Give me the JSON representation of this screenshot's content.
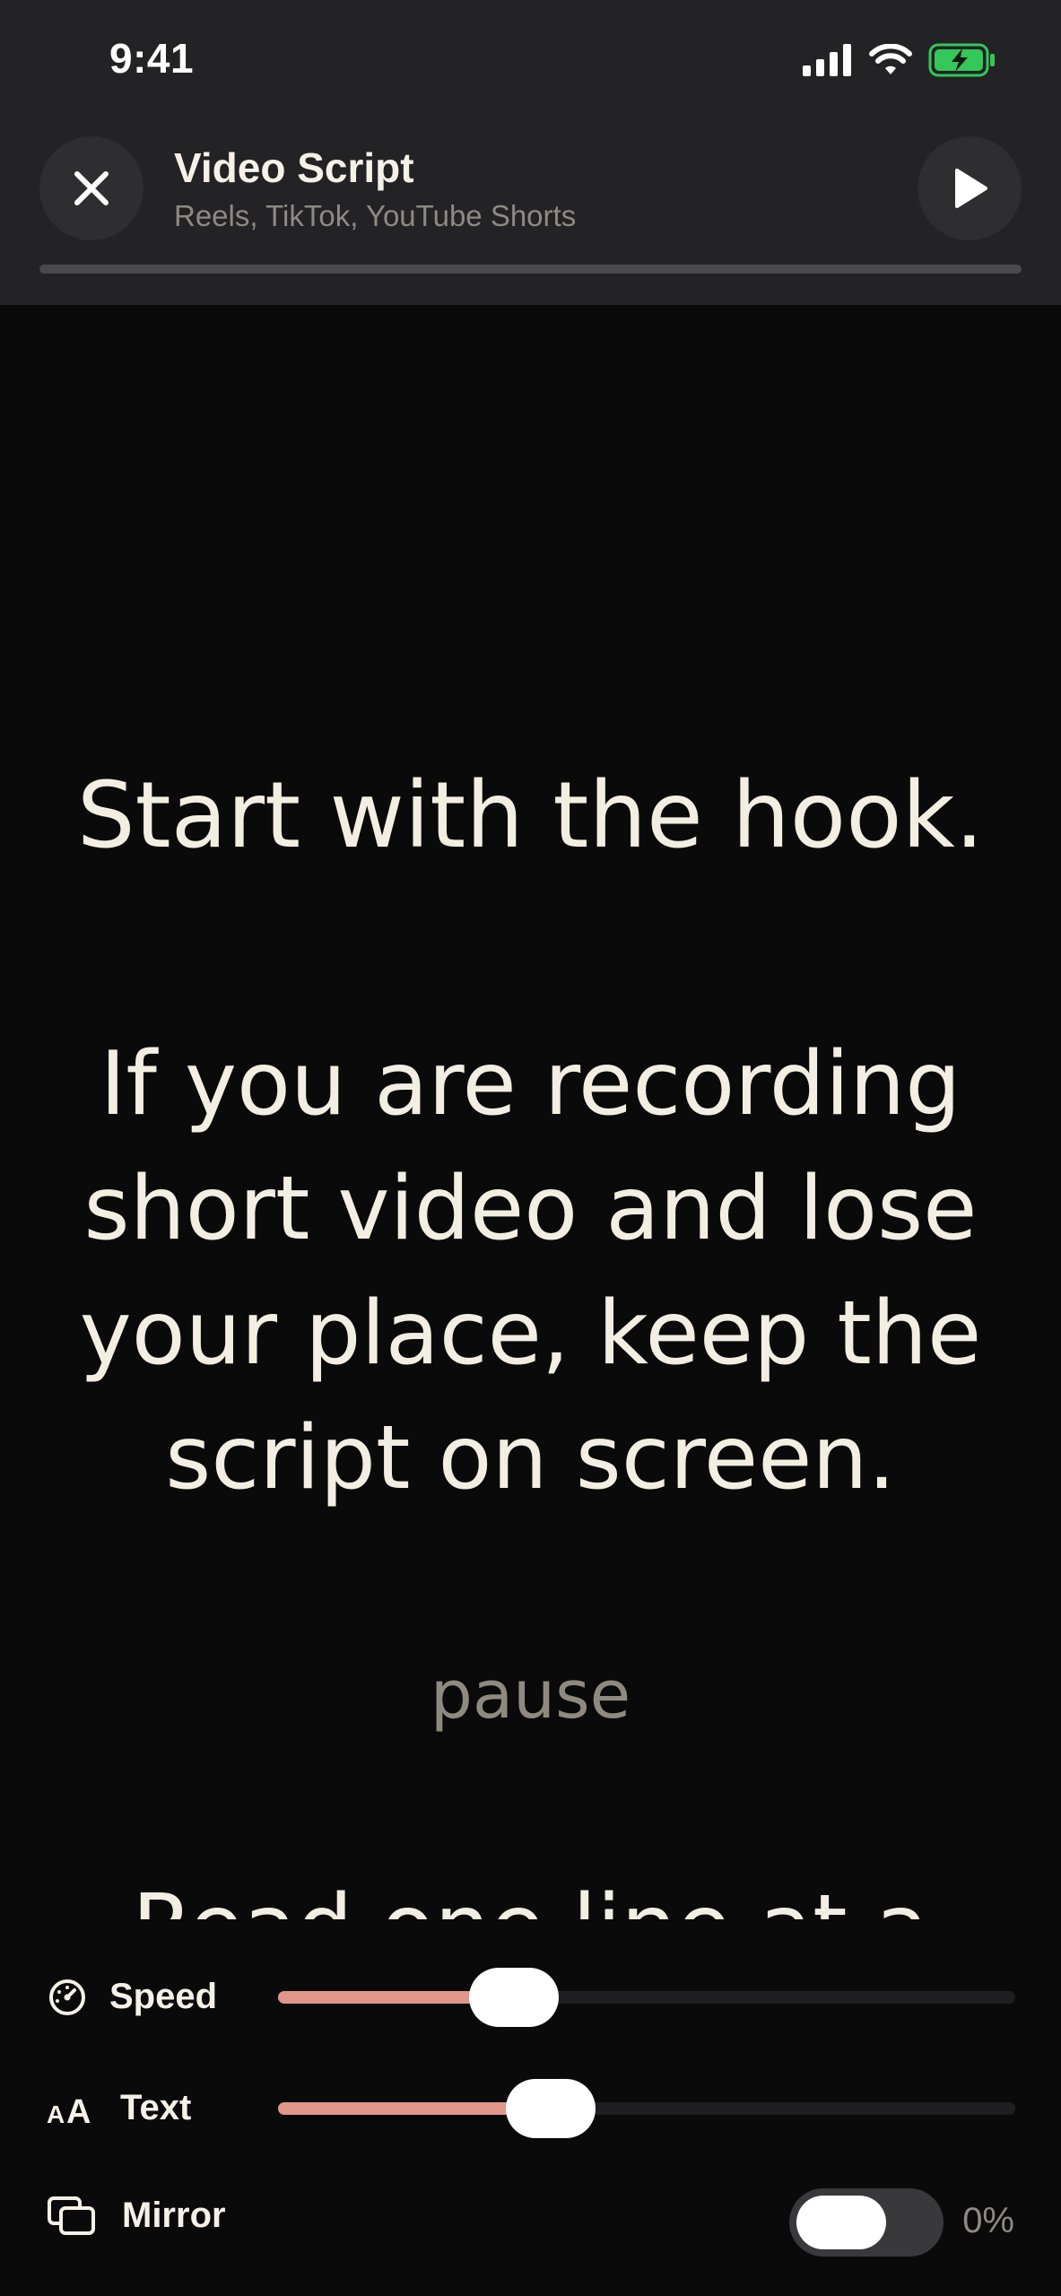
{
  "status_bar": {
    "time": "9:41"
  },
  "header": {
    "title": "Video Script",
    "subtitle": "Reels, TikTok, YouTube Shorts",
    "progress": 0
  },
  "script": {
    "hook": "Start with the hook.",
    "paragraph_lines": [
      "If you are recording",
      "short video and lose",
      "your place, keep the",
      "script on screen."
    ],
    "pause": "pause",
    "next_partial": "Read one line at a"
  },
  "controls": {
    "speed": {
      "label": "Speed",
      "value": 0.32
    },
    "text": {
      "label": "Text",
      "value": 0.37
    },
    "mirror": {
      "label": "Mirror",
      "value_text": "0%",
      "enabled": false
    }
  },
  "colors": {
    "accent": "#e1968a",
    "header_bg": "#232325",
    "background": "#0a0a0b",
    "text": "#f3eee2",
    "battery_green": "#34c759"
  },
  "icons": {
    "close": "close-icon",
    "play": "play-icon",
    "speed": "speedometer-icon",
    "text_size": "text-size-icon",
    "mirror": "mirror-icon"
  }
}
